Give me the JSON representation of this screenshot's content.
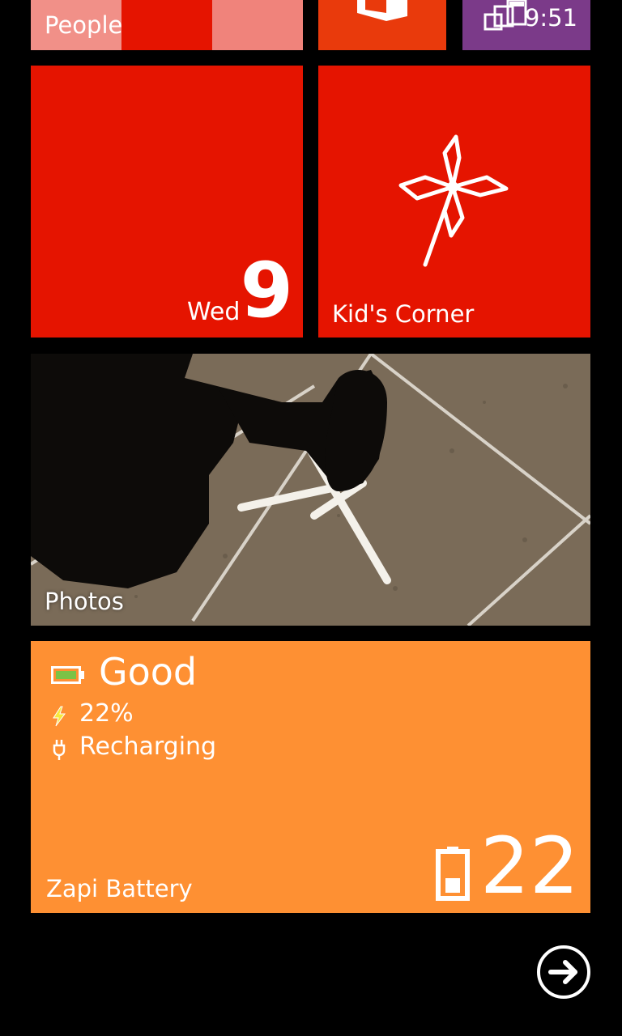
{
  "status_bar": {
    "time": "9:51"
  },
  "tiles": {
    "people": {
      "label": "People",
      "color": "#f0837b"
    },
    "office": {
      "icon": "office-icon",
      "color": "#e93a0c"
    },
    "games": {
      "icon": "games-icon",
      "color": "#7b3a89"
    },
    "calendar": {
      "day": "Wed",
      "date": "9",
      "color": "#e51400"
    },
    "kids_corner": {
      "label": "Kid's Corner",
      "icon": "pinwheel-icon",
      "color": "#e51400"
    },
    "photos": {
      "label": "Photos"
    },
    "zapi_battery": {
      "label": "Zapi Battery",
      "status": "Good",
      "percent": "22%",
      "state": "Recharging",
      "count": "22",
      "color": "#fe9033"
    }
  },
  "navigation": {
    "all_apps_icon": "arrow-right-circle-icon"
  }
}
